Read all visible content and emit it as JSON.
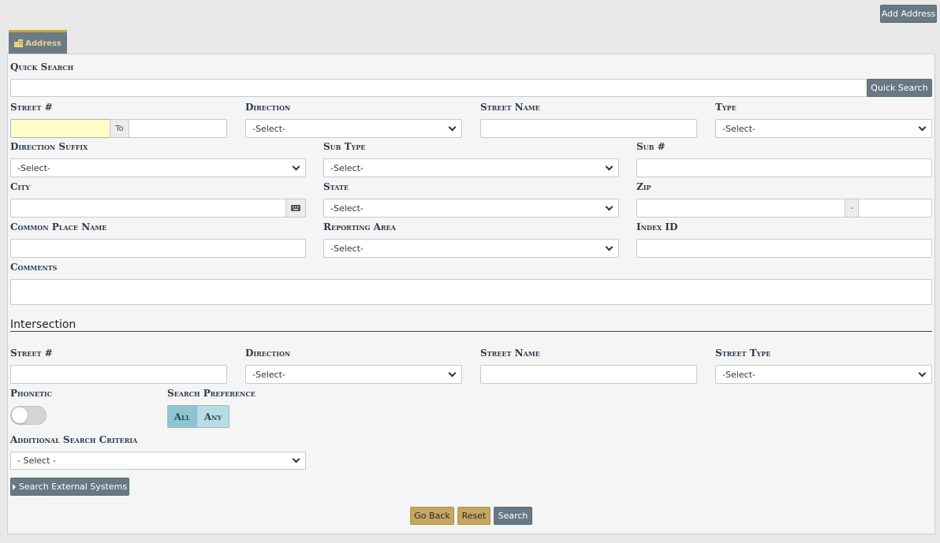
{
  "toolbar": {
    "add_address": "Add Address"
  },
  "tab": {
    "label": "Address",
    "icon": "building-icon"
  },
  "quick_search": {
    "label": "Quick Search",
    "value": "",
    "button": "Quick Search"
  },
  "address": {
    "street_no": {
      "label": "Street #",
      "value": "",
      "to_label": "To",
      "to_value": ""
    },
    "direction": {
      "label": "Direction",
      "selected": "-Select-"
    },
    "street_name": {
      "label": "Street Name",
      "value": ""
    },
    "type": {
      "label": "Type",
      "selected": "-Select-"
    },
    "direction_suffix": {
      "label": "Direction Suffix",
      "selected": "-Select-"
    },
    "sub_type": {
      "label": "Sub Type",
      "selected": "-Select-"
    },
    "sub_no": {
      "label": "Sub #",
      "value": ""
    },
    "city": {
      "label": "City",
      "value": ""
    },
    "state": {
      "label": "State",
      "selected": "-Select-"
    },
    "zip": {
      "label": "Zip",
      "value": "",
      "separator": "-",
      "ext": ""
    },
    "common_place": {
      "label": "Common Place Name",
      "value": ""
    },
    "reporting_area": {
      "label": "Reporting Area",
      "selected": "-Select-"
    },
    "index_id": {
      "label": "Index ID",
      "value": ""
    },
    "comments": {
      "label": "Comments",
      "value": ""
    }
  },
  "intersection": {
    "title": "Intersection",
    "street_no": {
      "label": "Street #",
      "value": ""
    },
    "direction": {
      "label": "Direction",
      "selected": "-Select-"
    },
    "street_name": {
      "label": "Street Name",
      "value": ""
    },
    "street_type": {
      "label": "Street Type",
      "selected": "-Select-"
    }
  },
  "phonetic": {
    "label": "Phonetic",
    "on": false
  },
  "search_preference": {
    "label": "Search Preference",
    "options": [
      "All",
      "Any"
    ],
    "selected": "All"
  },
  "additional": {
    "label": "Additional Search Criteria",
    "selected": "- Select -"
  },
  "external": {
    "label": "Search External Systems"
  },
  "actions": {
    "go_back": "Go Back",
    "reset": "Reset",
    "search": "Search"
  },
  "colors": {
    "accent_gold": "#c4a65e",
    "slate": "#687885",
    "tab_top": "#c9a63f",
    "toggle_active": "#8fc5d0"
  }
}
